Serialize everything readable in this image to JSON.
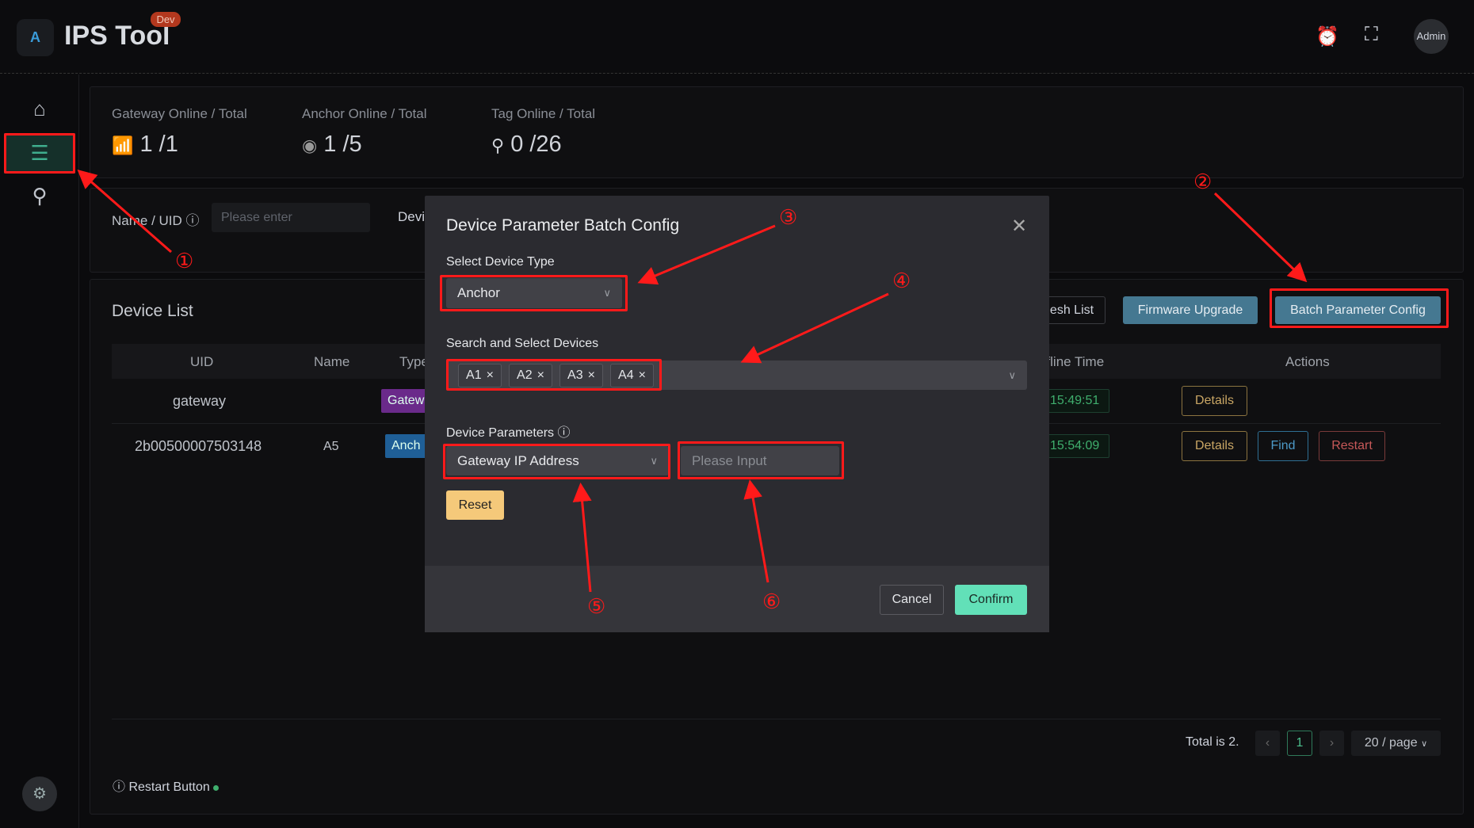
{
  "app": {
    "title": "IPS Tool",
    "env_badge": "Dev",
    "logo_letter": "A",
    "admin": "Admin"
  },
  "sidebar": {
    "items": [
      {
        "icon": "home-icon"
      },
      {
        "icon": "device-list-icon",
        "active": true
      },
      {
        "icon": "map-pin-icon"
      }
    ],
    "settings_icon": "gear-icon"
  },
  "stats": [
    {
      "label": "Gateway Online / Total",
      "value": "1 /1",
      "icon": "gateway-icon"
    },
    {
      "label": "Anchor Online / Total",
      "value": "1 /5",
      "icon": "anchor-icon"
    },
    {
      "label": "Tag Online / Total",
      "value": "0 /26",
      "icon": "tag-pin-icon"
    }
  ],
  "filter": {
    "name_label": "Name / UID",
    "name_placeholder": "Please enter",
    "device_label": "Devi"
  },
  "device_list": {
    "title": "Device List",
    "refresh": "esh List",
    "firmware": "Firmware Upgrade",
    "batch": "Batch Parameter Config",
    "columns": {
      "uid": "UID",
      "name": "Name",
      "type": "Type",
      "offline": "ffline Time",
      "actions": "Actions"
    },
    "rows": [
      {
        "uid": "gateway",
        "name": "",
        "type": "Gatew",
        "time": "15:49:51",
        "actions": [
          "Details"
        ]
      },
      {
        "uid": "2b00500007503148",
        "name": "A5",
        "type": "Anch",
        "time": "15:54:09",
        "actions": [
          "Details",
          "Find",
          "Restart"
        ]
      }
    ],
    "total": "Total is 2.",
    "page": "1",
    "page_size": "20 / page",
    "restart_hint": "Restart Button"
  },
  "modal": {
    "title": "Device Parameter Batch Config",
    "device_type_label": "Select Device Type",
    "device_type": "Anchor",
    "devices_label": "Search and Select Devices",
    "devices": [
      "A1",
      "A2",
      "A3",
      "A4"
    ],
    "params_label": "Device Parameters",
    "param": "Gateway IP Address",
    "value_placeholder": "Please Input",
    "reset": "Reset",
    "cancel": "Cancel",
    "confirm": "Confirm"
  },
  "annotations": [
    "①",
    "②",
    "③",
    "④",
    "⑤",
    "⑥"
  ],
  "colors": {
    "accent": "#3fae6d",
    "primary_button": "#457891",
    "confirm": "#62e0b8",
    "reset": "#f5c97a",
    "annotation": "#ff1a1a"
  }
}
